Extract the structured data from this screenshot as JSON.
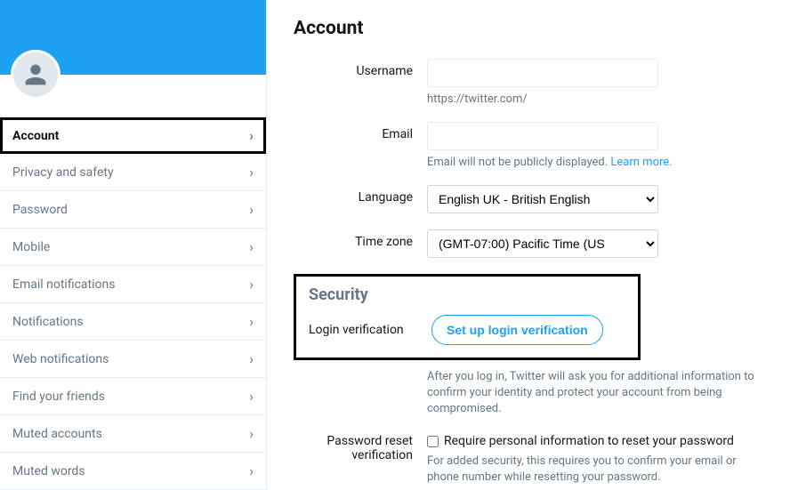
{
  "sidebar": {
    "items": [
      {
        "label": "Account"
      },
      {
        "label": "Privacy and safety"
      },
      {
        "label": "Password"
      },
      {
        "label": "Mobile"
      },
      {
        "label": "Email notifications"
      },
      {
        "label": "Notifications"
      },
      {
        "label": "Web notifications"
      },
      {
        "label": "Find your friends"
      },
      {
        "label": "Muted accounts"
      },
      {
        "label": "Muted words"
      }
    ]
  },
  "main": {
    "title": "Account",
    "username_label": "Username",
    "username_value": "",
    "username_helper": "https://twitter.com/",
    "email_label": "Email",
    "email_value": "",
    "email_helper_prefix": "Email will not be publicly displayed. ",
    "email_helper_link": "Learn more",
    "language_label": "Language",
    "language_value": "English UK - British English",
    "timezone_label": "Time zone",
    "timezone_value": "(GMT-07:00) Pacific Time (US",
    "security_title": "Security",
    "login_verification_label": "Login verification",
    "login_verification_button": "Set up login verification",
    "login_verification_helper": "After you log in, Twitter will ask you for additional information to confirm your identity and protect your account from being compromised.",
    "password_reset_label": "Password reset verification",
    "password_reset_checkbox_label": "Require personal information to reset your password",
    "password_reset_helper": "For added security, this requires you to confirm your email or phone number while resetting your password."
  }
}
